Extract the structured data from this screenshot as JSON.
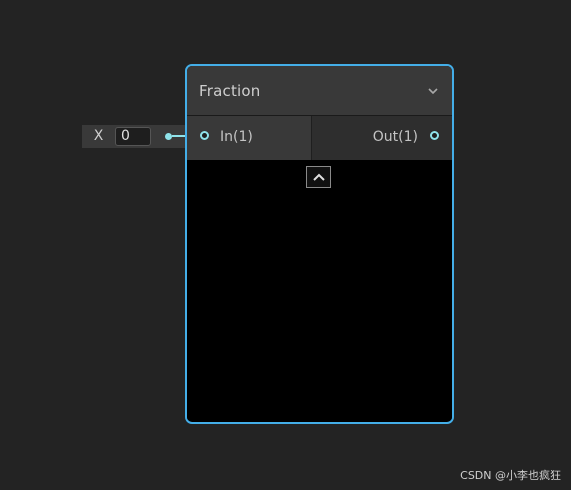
{
  "input_field": {
    "axis_label": "X",
    "value": "0",
    "dot_icon": "port-dot-icon"
  },
  "node": {
    "title": "Fraction",
    "collapse_icon": "chevron-down-icon",
    "input_port": {
      "label": "In(1)",
      "icon": "port-circle-icon"
    },
    "output_port": {
      "label": "Out(1)",
      "icon": "port-circle-icon"
    },
    "preview_toggle_icon": "chevron-up-icon"
  },
  "colors": {
    "accent": "#44aee8",
    "port": "#8fe3ea",
    "background": "#232323"
  },
  "watermark": "CSDN @小李也疯狂"
}
